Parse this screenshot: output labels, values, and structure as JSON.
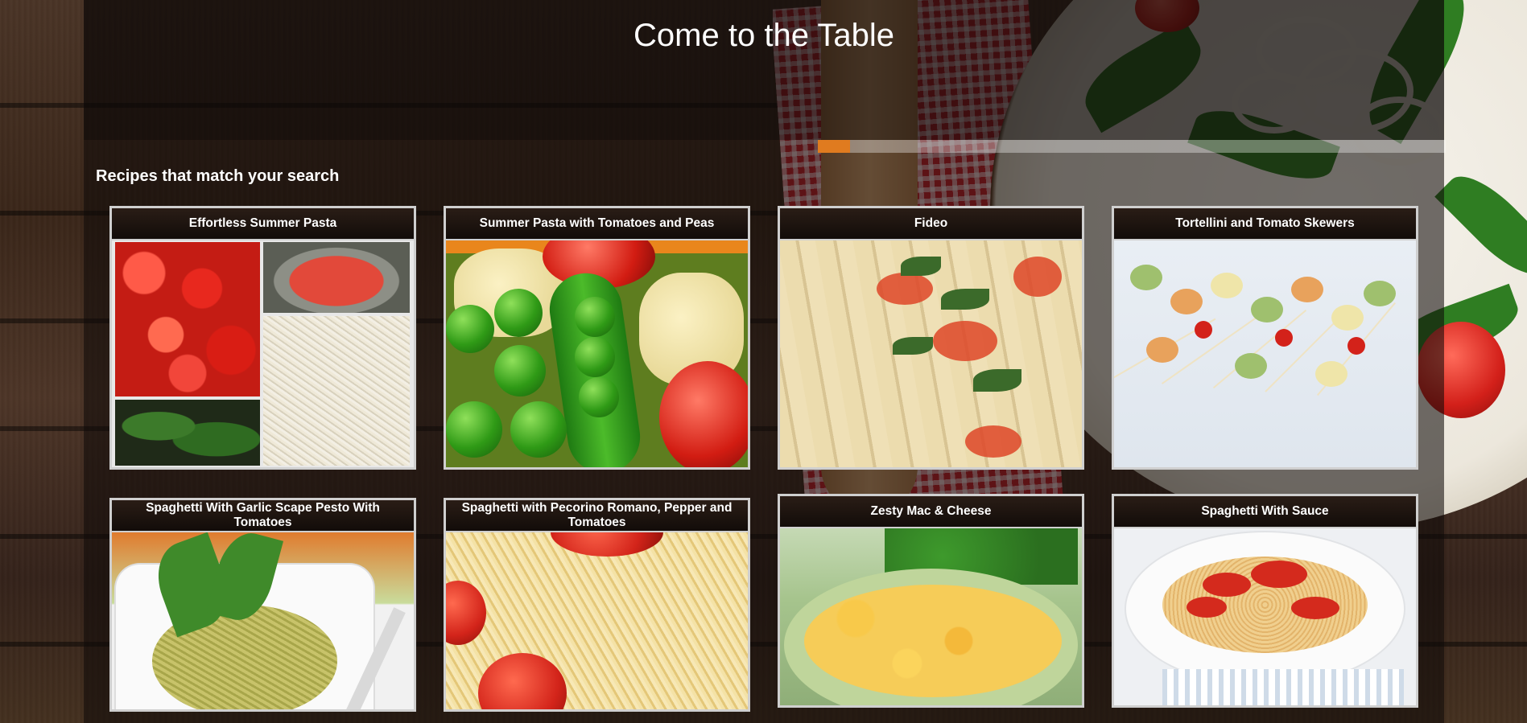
{
  "header": {
    "site_title": "Come to the Table"
  },
  "results": {
    "heading": "Recipes that match your search",
    "recipes": [
      {
        "title": "Effortless Summer Pasta",
        "image": "pasta-collage-image"
      },
      {
        "title": "Summer Pasta with Tomatoes and Peas",
        "image": "peas-pasta-image"
      },
      {
        "title": "Fideo",
        "image": "fideo-image"
      },
      {
        "title": "Tortellini and Tomato Skewers",
        "image": "skewers-image"
      },
      {
        "title": "Spaghetti With Garlic Scape Pesto With Tomatoes",
        "image": "pesto-spaghetti-image"
      },
      {
        "title": "Spaghetti with Pecorino Romano, Pepper and Tomatoes",
        "image": "pecorino-spaghetti-image"
      },
      {
        "title": "Zesty Mac & Cheese",
        "image": "mac-cheese-image"
      },
      {
        "title": "Spaghetti With Sauce",
        "image": "spaghetti-sauce-image"
      }
    ]
  },
  "colors": {
    "accent_orange": "#e07b1f",
    "card_border": "#cfcfcf",
    "title_text": "#ffffff"
  }
}
